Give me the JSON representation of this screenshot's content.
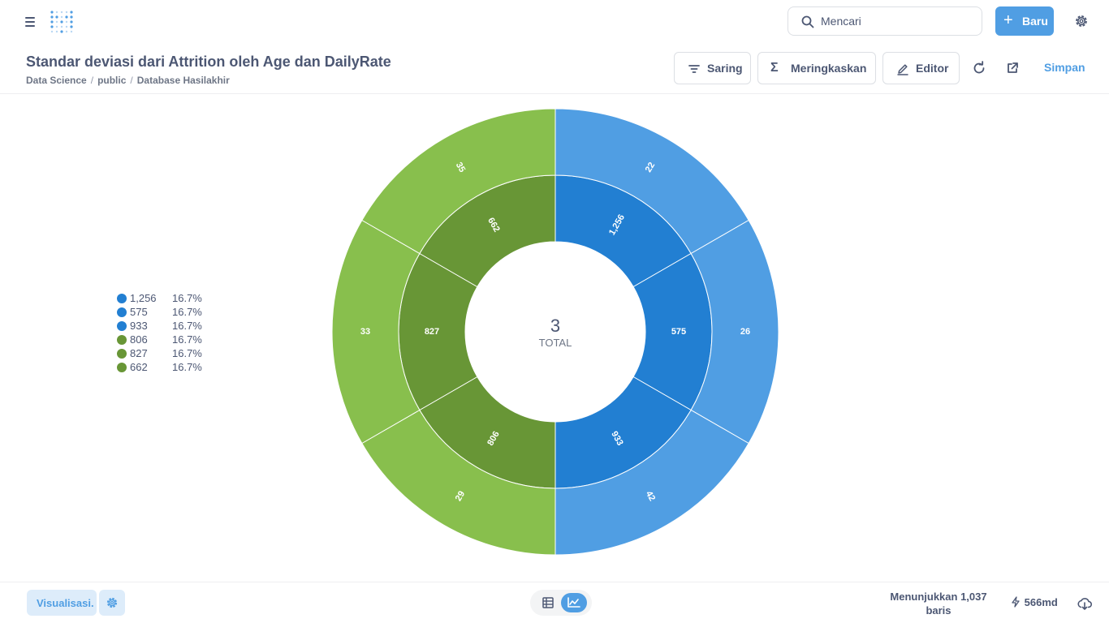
{
  "nav": {
    "search_placeholder": "Mencari",
    "new_label": "Baru"
  },
  "header": {
    "title": "Standar deviasi dari Attrition oleh Age dan DailyRate",
    "breadcrumb": [
      "Data Science",
      "public",
      "Database Hasilakhir"
    ],
    "buttons": {
      "filter": "Saring",
      "summarize": "Meringkaskan",
      "editor": "Editor"
    },
    "save_label": "Simpan"
  },
  "legend": [
    {
      "name": "1,256",
      "pct": "16.7%",
      "color": "#227fd2"
    },
    {
      "name": "575",
      "pct": "16.7%",
      "color": "#227fd2"
    },
    {
      "name": "933",
      "pct": "16.7%",
      "color": "#227fd2"
    },
    {
      "name": "806",
      "pct": "16.7%",
      "color": "#689636"
    },
    {
      "name": "827",
      "pct": "16.7%",
      "color": "#689636"
    },
    {
      "name": "662",
      "pct": "16.7%",
      "color": "#689636"
    }
  ],
  "chart_data": {
    "type": "pie",
    "center_value": "3",
    "center_label": "TOTAL",
    "inner_ring": {
      "labels": [
        "1,256",
        "575",
        "933",
        "806",
        "827",
        "662"
      ],
      "values": [
        1,
        1,
        1,
        1,
        1,
        1
      ],
      "colors": [
        "#227fd2",
        "#227fd2",
        "#227fd2",
        "#689636",
        "#689636",
        "#689636"
      ]
    },
    "outer_ring": {
      "labels": [
        "22",
        "26",
        "42",
        "29",
        "33",
        "35"
      ],
      "values": [
        1,
        1,
        1,
        1,
        1,
        1
      ],
      "colors": [
        "#509ee3",
        "#509ee3",
        "#509ee3",
        "#88bf4d",
        "#88bf4d",
        "#88bf4d"
      ]
    },
    "legend_position": "left"
  },
  "footer": {
    "viz_label": "Visualisasi.",
    "rowcount_line1": "Menunjukkan 1,037",
    "rowcount_line2": "baris",
    "timing": "566md"
  }
}
